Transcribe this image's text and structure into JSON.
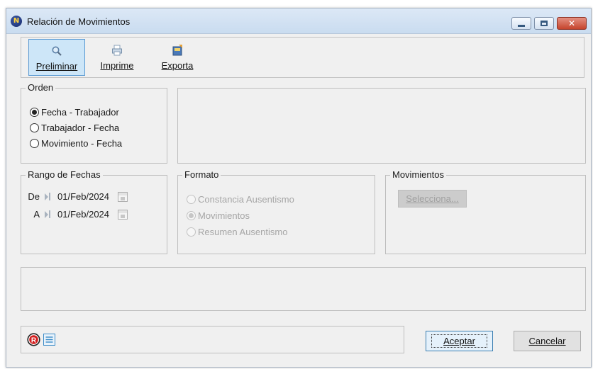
{
  "window": {
    "title": "Relación de Movimientos",
    "app_icon_glyph": "N",
    "controls": {
      "minimize": "minimize-icon",
      "maximize": "maximize-icon",
      "close": "close-icon",
      "close_glyph": "✕"
    }
  },
  "toolbar": {
    "buttons": [
      {
        "label": "Preliminar",
        "icon": "magnifier-icon",
        "active": true
      },
      {
        "label": "Imprime",
        "icon": "printer-icon",
        "active": false
      },
      {
        "label": "Exporta",
        "icon": "export-icon",
        "active": false
      }
    ]
  },
  "orden": {
    "legend": "Orden",
    "options": [
      {
        "label": "Fecha - Trabajador",
        "selected": true
      },
      {
        "label": "Trabajador - Fecha",
        "selected": false
      },
      {
        "label": "Movimiento - Fecha",
        "selected": false
      }
    ]
  },
  "rango": {
    "legend": "Rango de Fechas",
    "de_label": "De",
    "de_value": "01/Feb/2024",
    "a_label": "A",
    "a_value": "01/Feb/2024"
  },
  "formato": {
    "legend": "Formato",
    "options": [
      {
        "label": "Constancia Ausentismo",
        "selected": false,
        "enabled": false
      },
      {
        "label": "Movimientos",
        "selected": true,
        "enabled": false
      },
      {
        "label": "Resumen Ausentismo",
        "selected": false,
        "enabled": false
      }
    ]
  },
  "movimientos": {
    "legend": "Movimientos",
    "button_label": "Selecciona..."
  },
  "footer": {
    "accept_label": "Aceptar",
    "cancel_label": "Cancelar",
    "icons": [
      "registered-icon",
      "notes-icon"
    ]
  },
  "colors": {
    "window_bg": "#f0f0f0",
    "toolbar_active_bg": "#cde6f8",
    "toolbar_active_border": "#5c9bd3",
    "default_button_border": "#3c7fb1",
    "disabled_text": "#a6a6a6"
  }
}
